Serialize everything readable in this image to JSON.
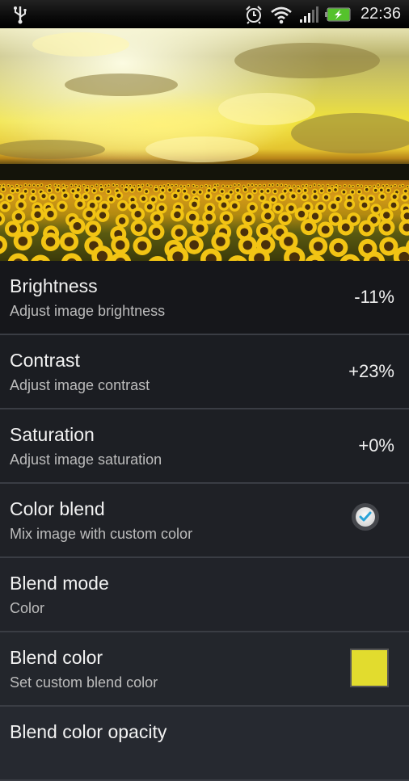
{
  "status_bar": {
    "time": "22:36",
    "icons": [
      "usb-icon",
      "alarm-icon",
      "wifi-icon",
      "signal-icon",
      "battery-charging-icon"
    ]
  },
  "preview": {
    "description": "Sunflower field at sunset wallpaper preview"
  },
  "settings": [
    {
      "title": "Brightness",
      "summary": "Adjust image brightness",
      "value": "-11%"
    },
    {
      "title": "Contrast",
      "summary": "Adjust image contrast",
      "value": "+23%"
    },
    {
      "title": "Saturation",
      "summary": "Adjust image saturation",
      "value": "+0%"
    },
    {
      "title": "Color blend",
      "summary": "Mix image with custom color",
      "checked": true
    },
    {
      "title": "Blend mode",
      "summary": "Color"
    },
    {
      "title": "Blend color",
      "summary": "Set custom blend color",
      "color": "#e2dc2e"
    },
    {
      "title": "Blend color opacity",
      "summary": ""
    }
  ],
  "colors": {
    "check_accent": "#2aa3d8",
    "blend_color": "#e2dc2e"
  }
}
